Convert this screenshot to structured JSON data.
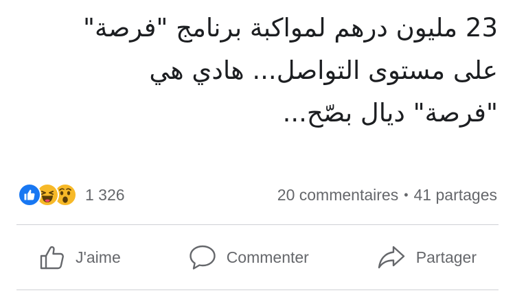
{
  "post": {
    "text_lines": [
      "23 مليون درهم لمواكبة برنامج \"فرصة\"",
      "على مستوى التواصل... هادي هي",
      "\"فرصة\" ديال بصّح..."
    ]
  },
  "stats": {
    "reactions": [
      "like-icon",
      "haha-icon",
      "wow-icon"
    ],
    "reaction_count": "1 326",
    "comments": "20 commentaires",
    "separator": "•",
    "shares": "41 partages"
  },
  "actions": {
    "like_label": "J'aime",
    "comment_label": "Commenter",
    "share_label": "Partager"
  },
  "colors": {
    "text": "#1c1e21",
    "secondary": "#65676b",
    "like_blue": "#1877f2",
    "emoji_yellow": "#f7b928",
    "divider": "#ced0d4"
  }
}
